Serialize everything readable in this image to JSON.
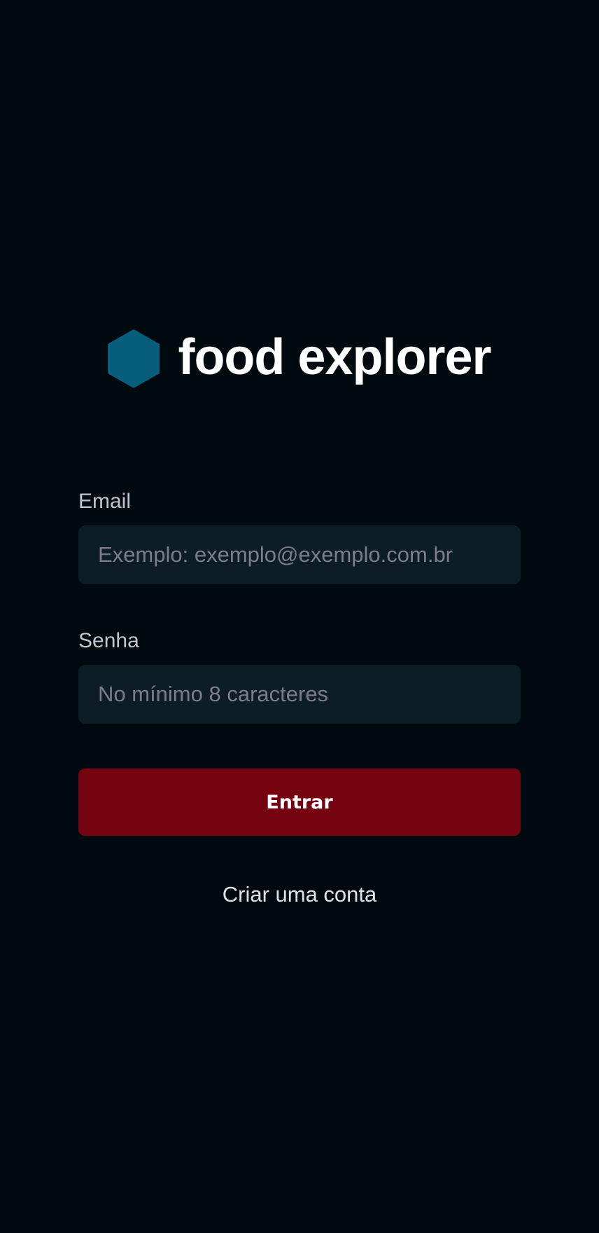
{
  "brand": {
    "name": "food explorer",
    "logo_icon": "hexagon-icon",
    "logo_color": "#065E7C"
  },
  "form": {
    "email": {
      "label": "Email",
      "value": "",
      "placeholder": "Exemplo: exemplo@exemplo.com.br"
    },
    "password": {
      "label": "Senha",
      "value": "",
      "placeholder": "No mínimo 8 caracteres"
    },
    "submit_label": "Entrar",
    "create_account_label": "Criar uma conta"
  },
  "colors": {
    "background": "#000A0F",
    "input_background": "#0D1D25",
    "button_background": "#750310",
    "label_text": "#C4C4CC",
    "placeholder_text": "#7C7C8A"
  }
}
